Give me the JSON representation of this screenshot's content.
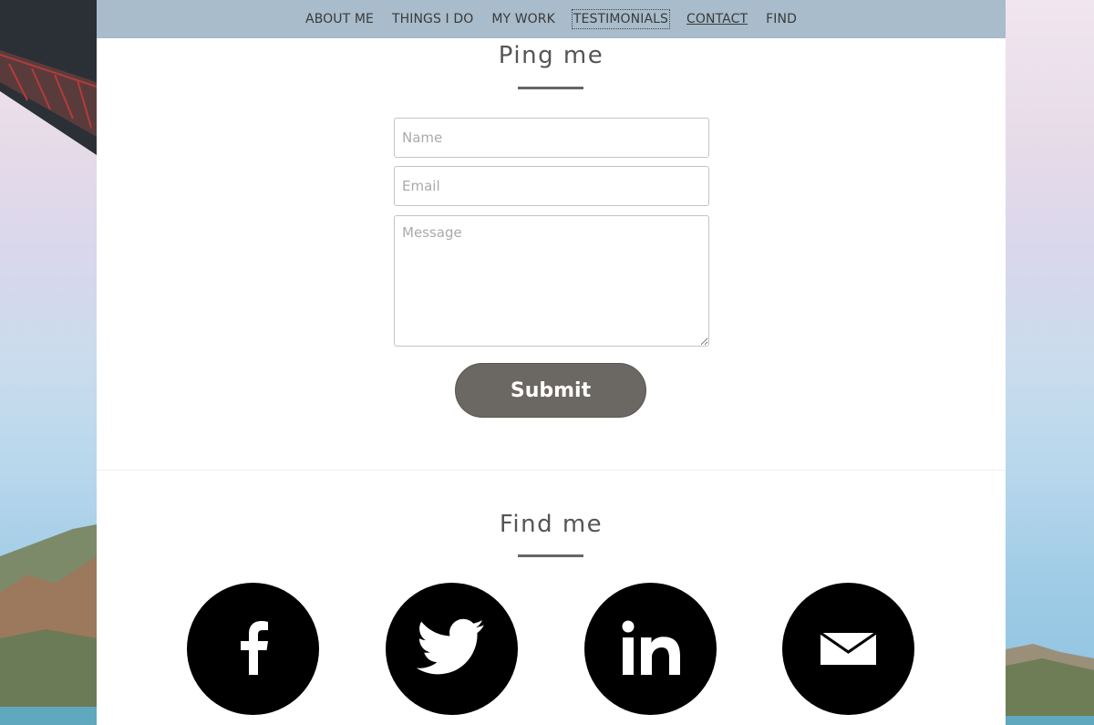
{
  "nav": {
    "items": [
      {
        "label": "ABOUT ME"
      },
      {
        "label": "THINGS I DO"
      },
      {
        "label": "MY WORK"
      },
      {
        "label": "TESTIMONIALS"
      },
      {
        "label": "CONTACT"
      },
      {
        "label": "FIND"
      }
    ],
    "focused_item": "TESTIMONIALS",
    "active_item": "CONTACT"
  },
  "ping": {
    "title": "Ping me",
    "name_placeholder": "Name",
    "email_placeholder": "Email",
    "message_placeholder": "Message",
    "submit_label": "Submit"
  },
  "find": {
    "title": "Find me",
    "social": [
      {
        "icon": "facebook-icon"
      },
      {
        "icon": "twitter-icon"
      },
      {
        "icon": "linkedin-icon"
      },
      {
        "icon": "email-icon"
      }
    ]
  },
  "colors": {
    "nav_bg": "#a8bccb",
    "button_bg": "#6b6762",
    "icon_bg": "#000000"
  }
}
